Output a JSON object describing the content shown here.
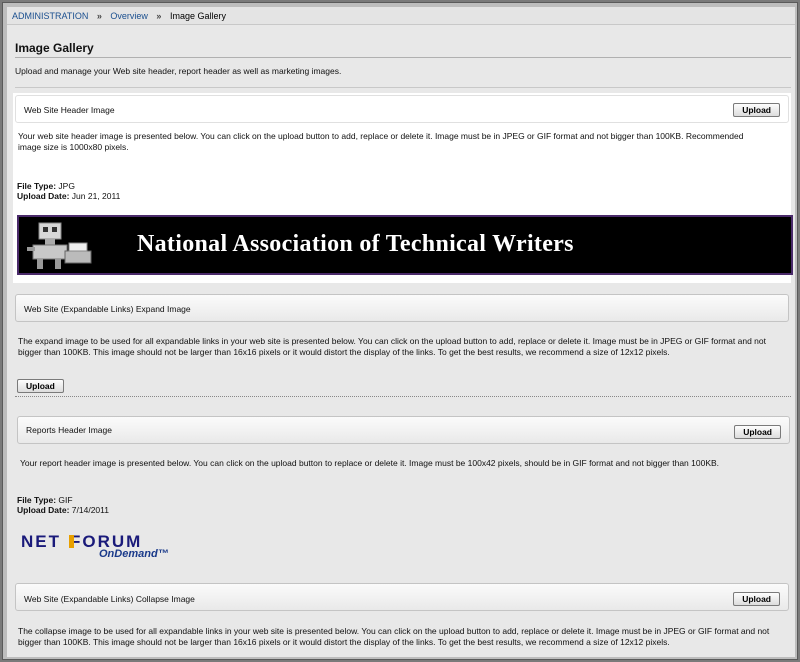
{
  "breadcrumb": {
    "root": "ADMINISTRATION",
    "separator": "»",
    "overview": "Overview",
    "current": "Image Gallery"
  },
  "page": {
    "title": "Image Gallery",
    "subtitle": "Upload and manage your Web site header, report header as well as marketing images."
  },
  "sections": {
    "website_header": {
      "title": "Web Site Header Image",
      "upload_label": "Upload",
      "description": "Your web site header image is presented below. You can click on the upload button to add, replace or delete it. Image must be in JPEG or GIF format and not bigger than 100KB. Recommended image size is 1000x80 pixels.",
      "file_type_label": "File Type:",
      "file_type": "JPG",
      "upload_date_label": "Upload Date:",
      "upload_date": "Jun 21, 2011",
      "banner_text": "National Association of Technical Writers"
    },
    "expand_image": {
      "title": "Web Site (Expandable Links) Expand Image",
      "description": "The expand image to be used for all expandable links in your web site is presented below. You can click on the upload button to add, replace or delete it. Image must be in JPEG or GIF format and not bigger than 100KB. This image should not be larger than 16x16 pixels or it would distort the display of the links. To get the best results, we recommend a size of 12x12 pixels.",
      "upload_label": "Upload"
    },
    "reports_header": {
      "title": "Reports Header Image",
      "upload_label": "Upload",
      "description": "Your report header image is presented below. You can click on the upload button to replace or delete it. Image must be 100x42 pixels, should be in GIF format and not bigger than 100KB.",
      "file_type_label": "File Type:",
      "file_type": "GIF",
      "upload_date_label": "Upload Date:",
      "upload_date": "7/14/2011",
      "logo_main_left": "NET",
      "logo_main_right": "FORUM",
      "logo_sub": "OnDemand™"
    },
    "collapse_image": {
      "title": "Web Site (Expandable Links) Collapse Image",
      "upload_label": "Upload",
      "description": "The collapse image to be used for all expandable links in your web site is presented below. You can click on the upload button to add, replace or delete it. Image must be in JPEG or GIF format and not bigger than 100KB. This image should not be larger than 16x16 pixels or it would distort the display of the links. To get the best results, we recommend a size of 12x12 pixels."
    }
  }
}
